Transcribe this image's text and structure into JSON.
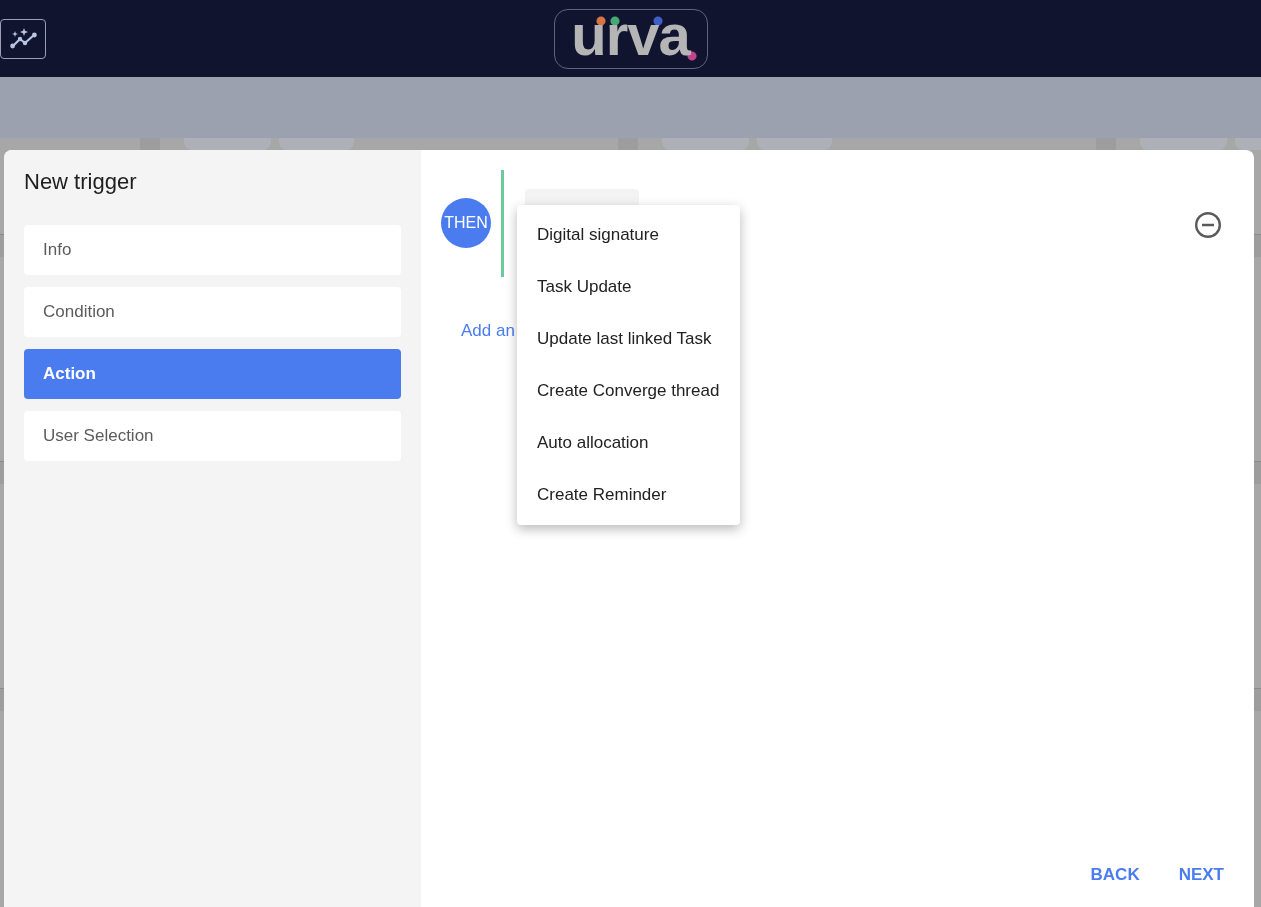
{
  "header": {
    "logo": "urva"
  },
  "dialog": {
    "title": "New trigger",
    "steps": [
      {
        "label": "Info",
        "selected": false
      },
      {
        "label": "Condition",
        "selected": false
      },
      {
        "label": "Action",
        "selected": true
      },
      {
        "label": "User Selection",
        "selected": false
      }
    ],
    "action": {
      "badge": "THEN",
      "add_link": "Add an",
      "menu": [
        "Digital signature",
        "Task Update",
        "Update last linked Task",
        "Create Converge thread",
        "Auto allocation",
        "Create Reminder"
      ]
    },
    "buttons": [
      "BACK",
      "NEXT"
    ]
  }
}
